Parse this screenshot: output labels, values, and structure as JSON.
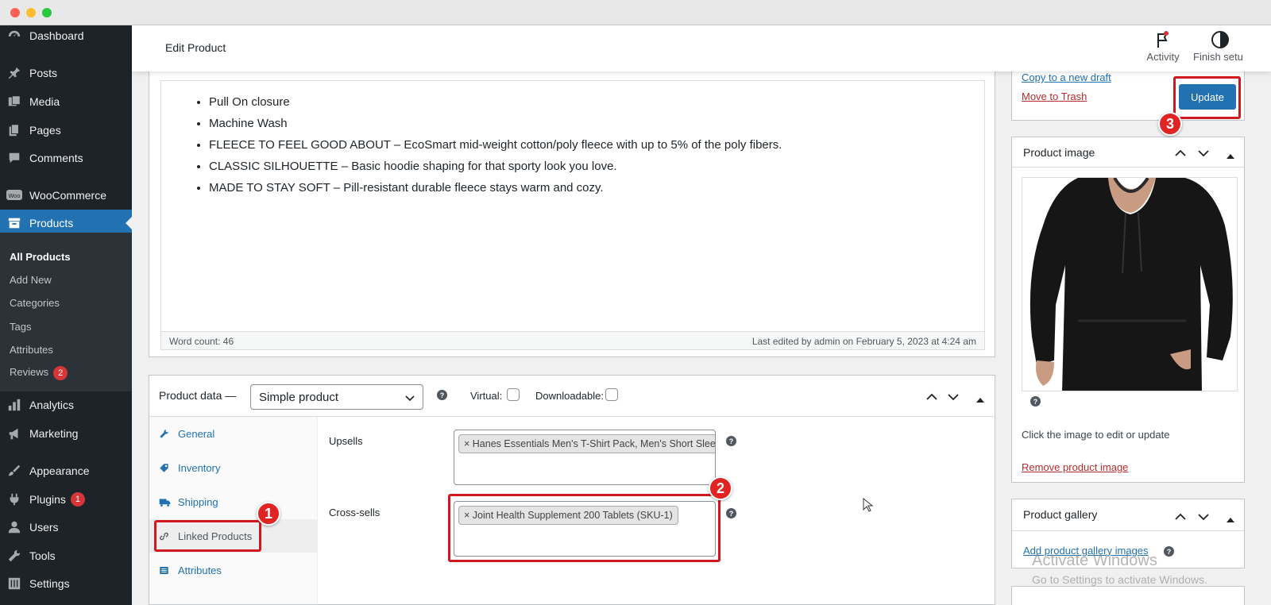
{
  "sidebar": {
    "items": [
      {
        "label": "Dashboard",
        "icon": "dashboard-icon"
      },
      {
        "label": "Posts",
        "icon": "pin-icon"
      },
      {
        "label": "Media",
        "icon": "media-icon"
      },
      {
        "label": "Pages",
        "icon": "pages-icon"
      },
      {
        "label": "Comments",
        "icon": "comment-icon"
      },
      {
        "label": "WooCommerce",
        "icon": "woo-icon"
      },
      {
        "label": "Products",
        "icon": "archive-icon"
      },
      {
        "label": "Analytics",
        "icon": "bar-chart-icon"
      },
      {
        "label": "Marketing",
        "icon": "megaphone-icon"
      },
      {
        "label": "Appearance",
        "icon": "brush-icon"
      },
      {
        "label": "Plugins",
        "icon": "plug-icon",
        "badge": "1"
      },
      {
        "label": "Users",
        "icon": "user-icon"
      },
      {
        "label": "Tools",
        "icon": "wrench-icon"
      },
      {
        "label": "Settings",
        "icon": "sliders-icon"
      }
    ],
    "submenu": [
      {
        "label": "All Products"
      },
      {
        "label": "Add New"
      },
      {
        "label": "Categories"
      },
      {
        "label": "Tags"
      },
      {
        "label": "Attributes"
      },
      {
        "label": "Reviews",
        "badge": "2"
      }
    ]
  },
  "header": {
    "title": "Edit Product",
    "activity_label": "Activity",
    "finish_setup_label": "Finish setu"
  },
  "editor": {
    "bullets": [
      "Pull On closure",
      "Machine Wash",
      "FLEECE TO FEEL GOOD ABOUT – EcoSmart mid-weight cotton/poly fleece with up to 5% of the poly fibers.",
      "CLASSIC SILHOUETTE – Basic hoodie shaping for that sporty look you love.",
      "MADE TO STAY SOFT – Pill-resistant durable fleece stays warm and cozy."
    ],
    "word_count": "Word count: 46",
    "last_edited": "Last edited by admin on February 5, 2023 at 4:24 am"
  },
  "product_data": {
    "title": "Product data —",
    "type_value": "Simple product",
    "virtual_label": "Virtual:",
    "downloadable_label": "Downloadable:",
    "tabs": [
      {
        "label": "General",
        "icon": "wrench-icon"
      },
      {
        "label": "Inventory",
        "icon": "tag-icon"
      },
      {
        "label": "Shipping",
        "icon": "truck-icon"
      },
      {
        "label": "Linked Products",
        "icon": "link-icon"
      },
      {
        "label": "Attributes",
        "icon": "list-icon"
      }
    ],
    "upsells_label": "Upsells",
    "upsells_token": "× Hanes Essentials Men's T-Shirt Pack, Men's Short Sleeve",
    "crosssells_label": "Cross-sells",
    "crosssells_token": "× Joint Health Supplement 200 Tablets (SKU-1)"
  },
  "publish": {
    "copy_draft": "Copy to a new draft",
    "trash": "Move to Trash",
    "update_label": "Update"
  },
  "product_image": {
    "title": "Product image",
    "hint": "Click the image to edit or update",
    "remove": "Remove product image"
  },
  "gallery": {
    "title": "Product gallery",
    "add": "Add product gallery images"
  },
  "watermark": {
    "line1": "Activate Windows",
    "line2": "Go to Settings to activate Windows."
  },
  "annotations": [
    "1",
    "2",
    "3"
  ],
  "colors": {
    "sidebar_bg": "#1d2327",
    "accent": "#2271b1",
    "highlight_red": "#d0191f"
  }
}
